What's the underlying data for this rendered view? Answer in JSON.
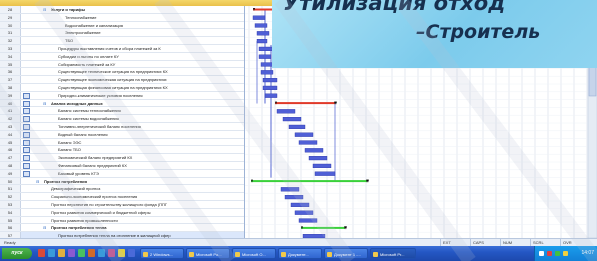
{
  "title_overlay": {
    "line1": "Утилизация отход",
    "line2": "–Строитель"
  },
  "rows": [
    {
      "num": "28",
      "name": "Услуги и тарифы",
      "level": 1,
      "summary": true
    },
    {
      "num": "29",
      "name": "Теплоснабжение",
      "level": 3
    },
    {
      "num": "30",
      "name": "Водоснабжение и канализация",
      "level": 3
    },
    {
      "num": "31",
      "name": "Электроснабжение",
      "level": 3
    },
    {
      "num": "32",
      "name": "ТБО",
      "level": 3
    },
    {
      "num": "33",
      "name": "Процедуры выставления счетов и сбора платежей за К",
      "level": 2
    },
    {
      "num": "34",
      "name": "Субсидии и льготы по оплате КУ",
      "level": 2
    },
    {
      "num": "35",
      "name": "Собираемость платежей за КУ",
      "level": 2
    },
    {
      "num": "36",
      "name": "Существующее техническое ситуация на предприятиях КХ",
      "level": 2
    },
    {
      "num": "37",
      "name": "Существующее экономическая ситуация на предприятиях",
      "level": 2
    },
    {
      "num": "38",
      "name": "Существующая финансовая ситуация на предприятиях КХ",
      "level": 2
    },
    {
      "num": "39",
      "name": "Природно-климатические условия поселения",
      "level": 2
    },
    {
      "num": "40",
      "name": "Анализ исходных данных",
      "level": 1,
      "summary": true
    },
    {
      "num": "41",
      "name": "Баланс системы теплоснабжения",
      "level": 2
    },
    {
      "num": "42",
      "name": "Баланс системы водоснабжения",
      "level": 2
    },
    {
      "num": "43",
      "name": "Топливно-энергетический баланс поселения",
      "level": 2
    },
    {
      "num": "44",
      "name": "Водный баланс поселения",
      "level": 2
    },
    {
      "num": "45",
      "name": "Баланс ЭЭС",
      "level": 2
    },
    {
      "num": "46",
      "name": "Баланс ТБО",
      "level": 2
    },
    {
      "num": "47",
      "name": "Экономический баланс предприятий КХ",
      "level": 2
    },
    {
      "num": "48",
      "name": "Финансовый баланс предприятий КХ",
      "level": 2
    },
    {
      "num": "49",
      "name": "Базовый уровень КТЭ",
      "level": 2
    },
    {
      "num": "50",
      "name": "Прогноз потребления",
      "level": 0,
      "summary": true
    },
    {
      "num": "51",
      "name": "Демографический прогноз",
      "level": 1
    },
    {
      "num": "52",
      "name": "Социально-экономический прогноз поселения",
      "level": 1
    },
    {
      "num": "53",
      "name": "Прогноз перспектив по строительству жилищного фонда (ППГ",
      "level": 1
    },
    {
      "num": "54",
      "name": "Прогноз развития коммерческой и бюджетной сферы",
      "level": 1
    },
    {
      "num": "55",
      "name": "Прогноз развития промышленности",
      "level": 1
    },
    {
      "num": "56",
      "name": "Прогноз потребления тепла",
      "level": 1,
      "summary": true
    },
    {
      "num": "57",
      "name": "Прогноз потребления тепла на отопление в жилищной сфер",
      "level": 2,
      "selected": true
    }
  ],
  "status_bar": {
    "ready": "Ready",
    "cells": [
      "EXT",
      "CAPS",
      "NUM",
      "SCRL",
      "OVR"
    ]
  },
  "taskbar": {
    "start_label": "пуск",
    "buttons": [
      "2 Windows...",
      "Microsoft Po...",
      "Microsoft O...",
      "Документ...",
      "Документ 1 -...",
      "Microsoft Pr..."
    ],
    "clock": "14:07"
  },
  "colors": {
    "task_bar": "#4f5fd6",
    "critical_bar": "#e03a2a",
    "summary_green": "#3ad13a",
    "link_blue": "#2a40c8",
    "title_text": "#17304f"
  }
}
